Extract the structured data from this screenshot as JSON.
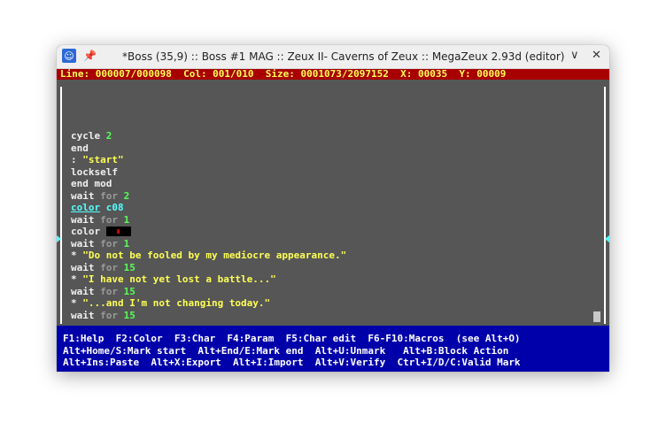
{
  "window": {
    "title": "*Boss (35,9) :: Boss #1 MAG :: Zeux II- Caverns of Zeux :: MegaZeux 2.93d (editor)",
    "minimize_glyph": "∨",
    "close_glyph": "✕"
  },
  "status": {
    "text": "Line: 000007/000098  Col: 001/010  Size: 0001073/2097152  X: 00035  Y: 00009"
  },
  "code_lines": [
    [
      {
        "t": "cycle ",
        "c": "w"
      },
      {
        "t": "2",
        "c": "g"
      }
    ],
    [
      {
        "t": "end",
        "c": "w"
      }
    ],
    [
      {
        "t": ": ",
        "c": "w"
      },
      {
        "t": "\"start\"",
        "c": "y"
      }
    ],
    [
      {
        "t": "lockself",
        "c": "w"
      }
    ],
    [
      {
        "t": "end mod",
        "c": "w"
      }
    ],
    [
      {
        "t": "wait ",
        "c": "w"
      },
      {
        "t": "for ",
        "c": "gr"
      },
      {
        "t": "2",
        "c": "g"
      }
    ],
    [
      {
        "t": "color",
        "c": "c",
        "u": true
      },
      {
        "t": " c08",
        "c": "c"
      }
    ],
    [
      {
        "t": "wait ",
        "c": "w"
      },
      {
        "t": "for ",
        "c": "gr"
      },
      {
        "t": "1",
        "c": "g"
      }
    ],
    [
      {
        "t": "color ",
        "c": "w"
      },
      {
        "swatch": true
      }
    ],
    [
      {
        "t": "wait ",
        "c": "w"
      },
      {
        "t": "for ",
        "c": "gr"
      },
      {
        "t": "1",
        "c": "g"
      }
    ],
    [
      {
        "t": "* ",
        "c": "w"
      },
      {
        "t": "\"Do not be fooled by my mediocre appearance.\"",
        "c": "y"
      }
    ],
    [
      {
        "t": "wait ",
        "c": "w"
      },
      {
        "t": "for ",
        "c": "gr"
      },
      {
        "t": "15",
        "c": "g"
      }
    ],
    [
      {
        "t": "* ",
        "c": "w"
      },
      {
        "t": "\"I have not yet lost a battle...\"",
        "c": "y"
      }
    ],
    [
      {
        "t": "wait ",
        "c": "w"
      },
      {
        "t": "for ",
        "c": "gr"
      },
      {
        "t": "15",
        "c": "g"
      }
    ],
    [
      {
        "t": "* ",
        "c": "w"
      },
      {
        "t": "\"...and I'm not changing today.\"",
        "c": "y"
      }
    ],
    [
      {
        "t": "wait ",
        "c": "w"
      },
      {
        "t": "for ",
        "c": "gr"
      },
      {
        "t": "15",
        "c": "g"
      }
    ]
  ],
  "help": {
    "line1": "F1:Help  F2:Color  F3:Char  F4:Param  F5:Char edit  F6-F10:Macros  (see Alt+O)",
    "line2": "Alt+Home/S:Mark start  Alt+End/E:Mark end  Alt+U:Unmark   Alt+B:Block Action",
    "line3": "Alt+Ins:Paste  Alt+X:Export  Alt+I:Import  Alt+V:Verify  Ctrl+I/D/C:Valid Mark"
  },
  "colors": {
    "status_bg": "#a80000",
    "status_fg": "#ffff55",
    "editor_bg": "#565656",
    "help_bg": "#0000aa",
    "keyword": "#f0f0f0",
    "number": "#55ff55",
    "string": "#ffff55",
    "secondary": "#9a9a9a",
    "current": "#55ffff"
  }
}
